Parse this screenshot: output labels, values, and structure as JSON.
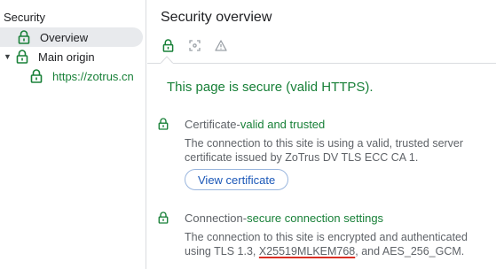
{
  "sidebar": {
    "title": "Security",
    "overview_label": "Overview",
    "main_origin_label": "Main origin",
    "origin_label": "https://zotrus.cn"
  },
  "panel": {
    "title": "Security overview",
    "secure_summary": "This page is secure (valid HTTPS).",
    "certificate": {
      "name": "Certificate",
      "sep": " - ",
      "state": "valid and trusted",
      "description": "The connection to this site is using a valid, trusted server certificate issued by ZoTrus DV TLS ECC CA 1.",
      "button": "View certificate"
    },
    "connection": {
      "name": "Connection",
      "sep": " - ",
      "state": "secure connection settings",
      "description_prefix": "The connection to this site is encrypted and authenticated using TLS 1.3, ",
      "key_exchange": "X25519MLKEM768",
      "description_suffix": ", and AES_256_GCM."
    }
  },
  "icons": {
    "lock": "lock-icon",
    "screenshot": "screenshot-icon",
    "warning": "warning-icon"
  },
  "colors": {
    "secure_green": "#188038",
    "selected_bg": "#e8eaed",
    "link_blue": "#1a57b8",
    "underline_red": "#d93025"
  }
}
